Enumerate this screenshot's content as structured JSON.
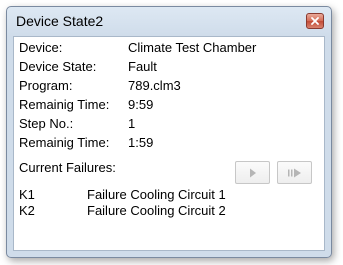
{
  "window": {
    "title": "Device State2"
  },
  "fields": [
    {
      "label": "Device:",
      "value": "Climate Test Chamber"
    },
    {
      "label": "Device State:",
      "value": "Fault"
    },
    {
      "label": "Program:",
      "value": "789.clm3"
    },
    {
      "label": "Remainig Time:",
      "value": "9:59"
    },
    {
      "label": "Step No.:",
      "value": "1"
    },
    {
      "label": "Remainig Time:",
      "value": "1:59"
    }
  ],
  "failures": {
    "header": "Current Failures:",
    "items": [
      {
        "code": "K1",
        "description": "Failure Cooling Circuit 1"
      },
      {
        "code": "K2",
        "description": "Failure Cooling Circuit 2"
      }
    ]
  },
  "controls": {
    "play_icon": "play-icon",
    "next_step_icon": "next-step-icon",
    "close_icon": "close-icon"
  }
}
